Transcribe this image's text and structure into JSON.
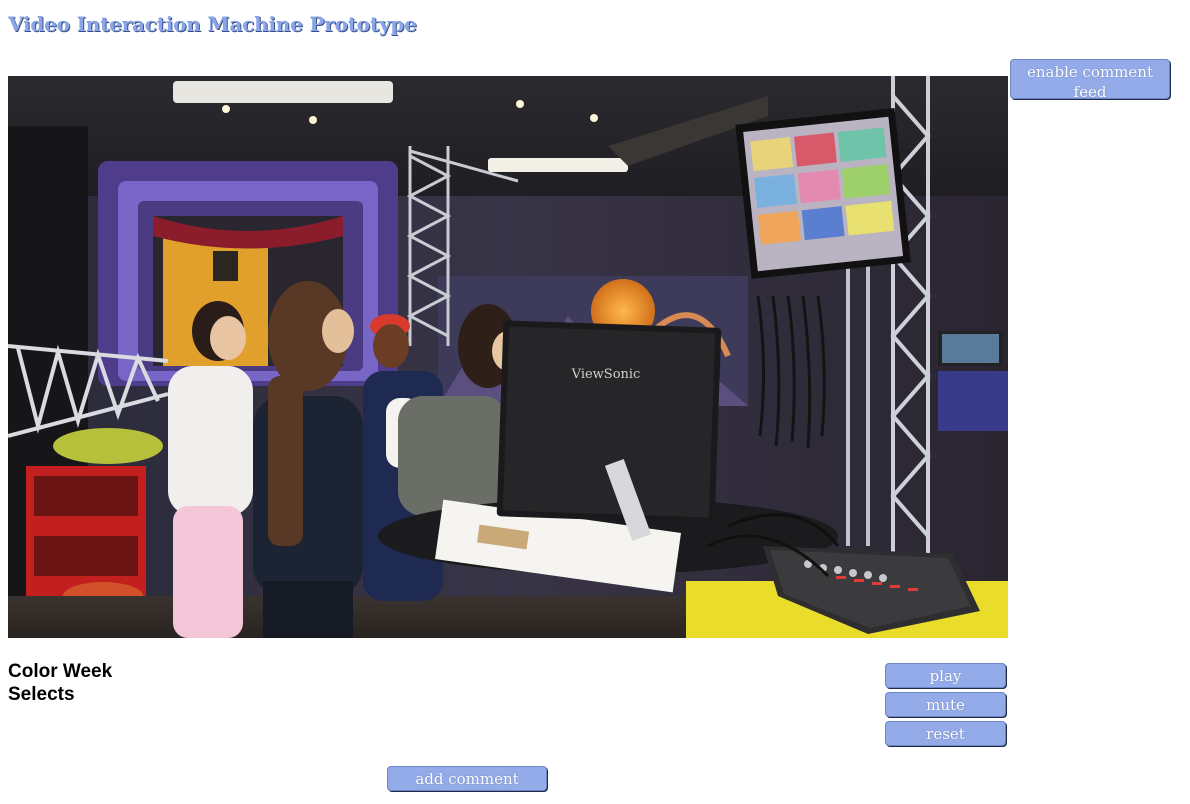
{
  "page": {
    "title": "Video Interaction Machine Prototype"
  },
  "comment_feed": {
    "toggle_label": "enable comment feed"
  },
  "video": {
    "title": "Color Week Selects",
    "monitor_brand": "ViewSonic"
  },
  "controls": {
    "play_label": "play",
    "mute_label": "mute",
    "reset_label": "reset"
  },
  "comments": {
    "add_label": "add comment"
  },
  "colors": {
    "title": "#8aa6e8",
    "button_bg": "#93abe9",
    "button_text": "#ffffff"
  },
  "icons": {
    "video": "video-frame"
  }
}
